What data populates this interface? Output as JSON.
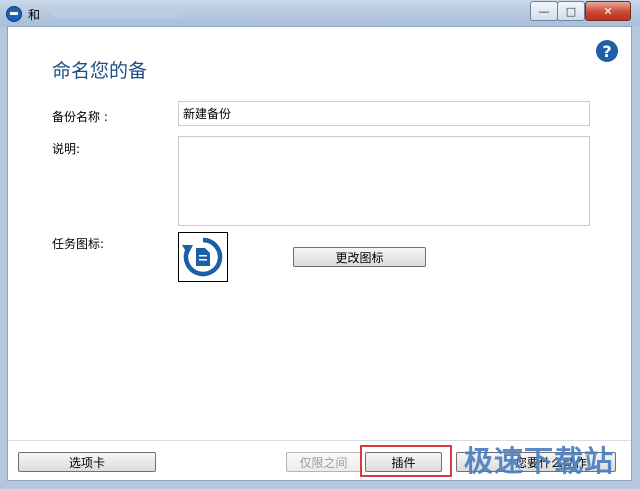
{
  "window": {
    "title": "和",
    "minimize_glyph": "—",
    "maximize_glyph": "□",
    "close_glyph": "✕"
  },
  "help": {
    "glyph": "?"
  },
  "page": {
    "title": "命名您的备"
  },
  "form": {
    "name_label": "备份名称 :",
    "name_value": "新建备份",
    "description_label": "说明:",
    "description_value": "",
    "icon_label": "任务图标:",
    "change_icon_label": "更改图标"
  },
  "footer": {
    "tabs_label": "选项卡",
    "previous_label": "仅限之间",
    "plugin_label": "插件",
    "next_label": "您要什么动作"
  },
  "watermark": {
    "text": "极速下载站"
  },
  "colors": {
    "title_blue": "#1d4f86",
    "help_blue": "#1f5fa8",
    "highlight_red": "#d63c3c",
    "icon_blue": "#1b62b5"
  },
  "icons": {
    "app": "backup-app-icon",
    "help": "help-icon",
    "task": "restore-document-icon"
  }
}
